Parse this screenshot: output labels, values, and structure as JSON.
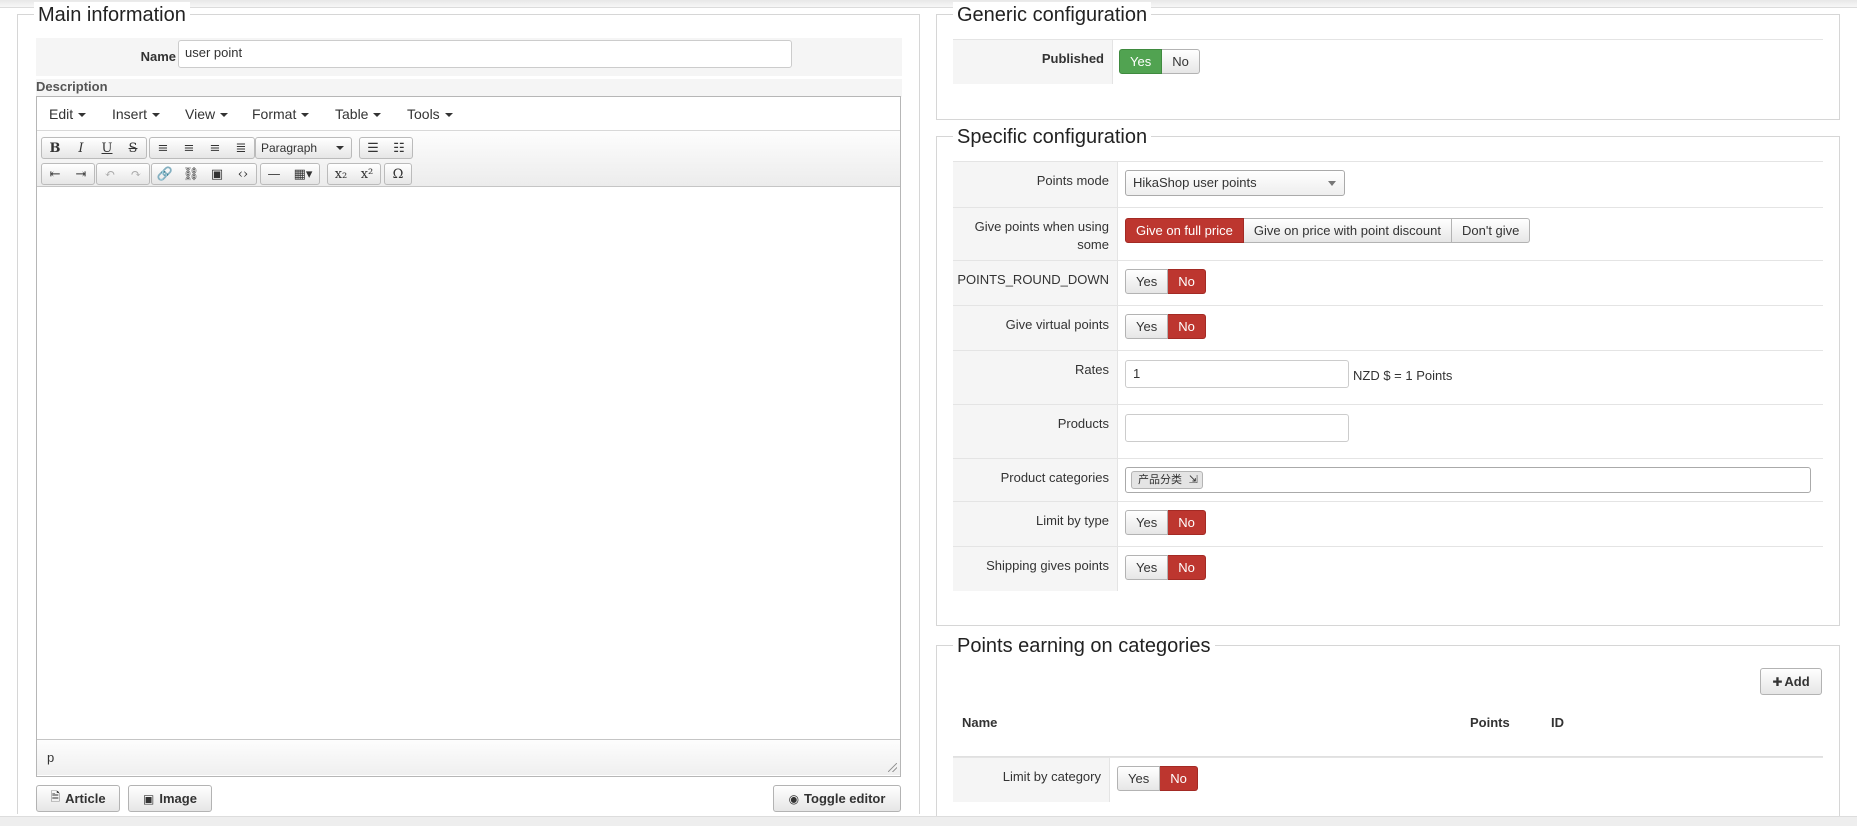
{
  "main": {
    "legend": "Main information",
    "name_label": "Name",
    "name_value": "user point",
    "description_label": "Description",
    "editor": {
      "menus": [
        "Edit",
        "Insert",
        "View",
        "Format",
        "Table",
        "Tools"
      ],
      "format_select": "Paragraph",
      "status_path": "p"
    },
    "buttons": {
      "article": "Article",
      "image": "Image",
      "toggle_editor": "Toggle editor"
    }
  },
  "generic": {
    "legend": "Generic configuration",
    "published_label": "Published",
    "yes": "Yes",
    "no": "No"
  },
  "specific": {
    "legend": "Specific configuration",
    "points_mode_label": "Points mode",
    "points_mode_value": "HikaShop user points",
    "give_points_label": "Give points when using some",
    "give_points_options": [
      "Give on full price",
      "Give on price with point discount",
      "Don't give"
    ],
    "round_down_label": "POINTS_ROUND_DOWN",
    "virtual_label": "Give virtual points",
    "rates_label": "Rates",
    "rates_value": "1",
    "rates_suffix": "NZD $ = 1 Points",
    "products_label": "Products",
    "products_value": "",
    "categories_label": "Product categories",
    "category_chip": "产品分类",
    "limit_type_label": "Limit by type",
    "shipping_label": "Shipping gives points",
    "yes": "Yes",
    "no": "No"
  },
  "earning": {
    "legend": "Points earning on categories",
    "add_label": "Add",
    "columns": [
      "Name",
      "Points",
      "ID"
    ],
    "limit_category_label": "Limit by category",
    "yes": "Yes",
    "no": "No"
  },
  "colors": {
    "active_red": "#bd362f",
    "active_green": "#51a351"
  }
}
